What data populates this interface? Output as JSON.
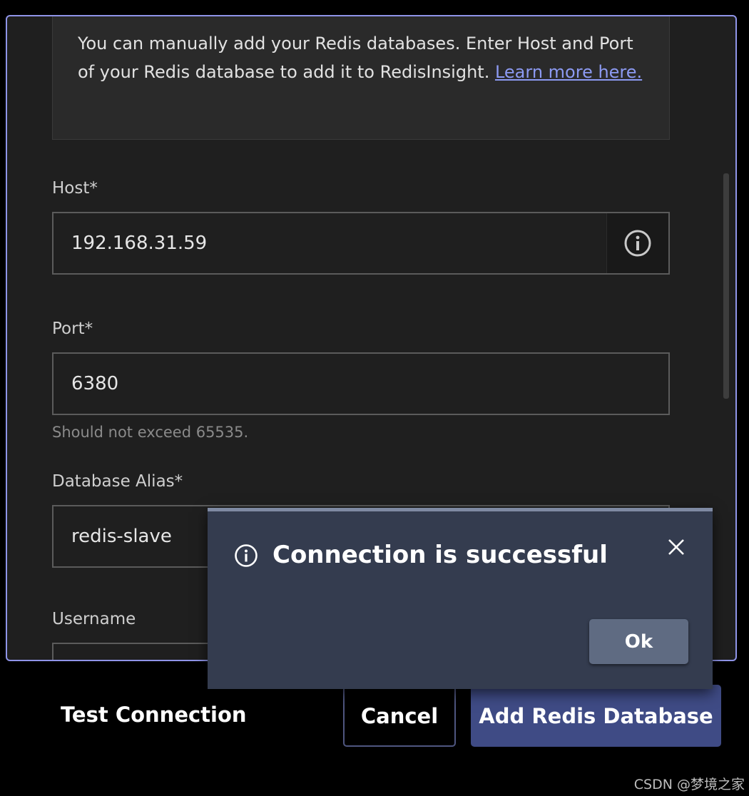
{
  "info_box": {
    "text": "You can manually add your Redis databases. Enter Host and Port of your Redis database to add it to RedisInsight. ",
    "link_text": "Learn more here."
  },
  "host": {
    "label": "Host*",
    "value": "192.168.31.59",
    "icon": "info-icon"
  },
  "port": {
    "label": "Port*",
    "value": "6380",
    "hint": "Should not exceed 65535."
  },
  "alias": {
    "label": "Database Alias*",
    "value": "redis-slave"
  },
  "username": {
    "label": "Username",
    "value": ""
  },
  "buttons": {
    "test_connection": "Test Connection",
    "cancel": "Cancel",
    "add_database": "Add Redis Database"
  },
  "modal": {
    "title": "Connection is successful",
    "ok_label": "Ok",
    "icon": "info-icon",
    "close_icon": "close-icon"
  },
  "watermark": "CSDN @梦境之家",
  "colors": {
    "panel_border": "#8f94e8",
    "primary_button": "#3f4b85",
    "modal_background": "#343c4f",
    "link": "#8c9af2"
  }
}
